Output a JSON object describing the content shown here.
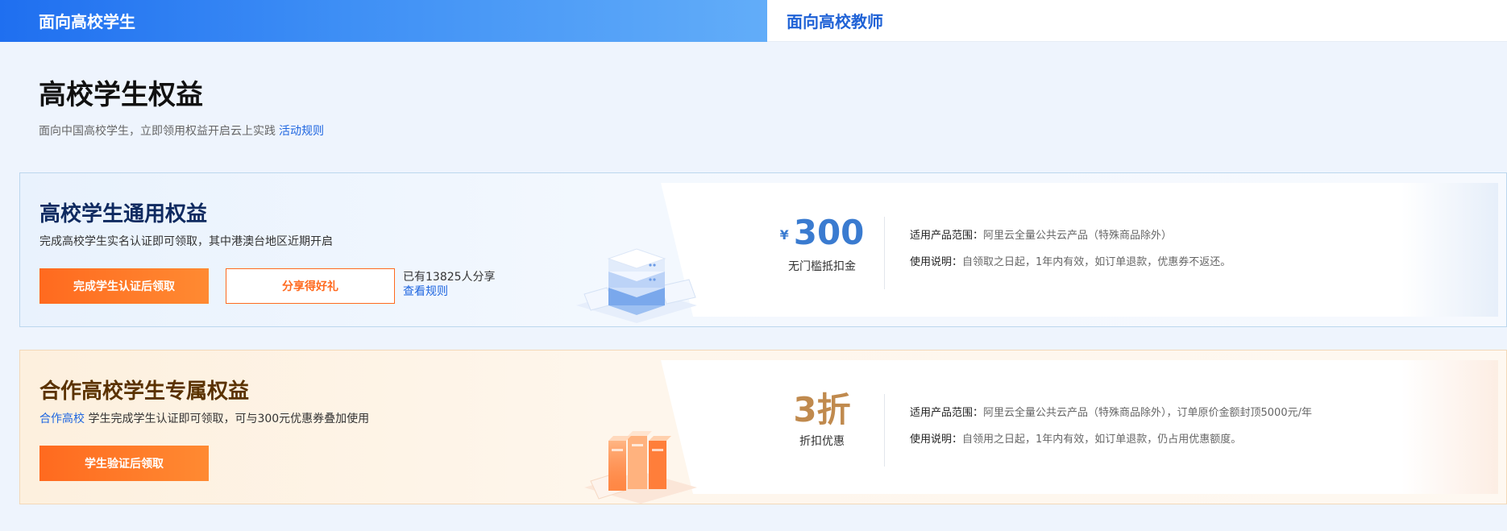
{
  "tabs": {
    "active": "面向高校学生",
    "inactive": "面向高校教师"
  },
  "page": {
    "title": "高校学生权益",
    "subtitle": "面向中国高校学生，立即领用权益开启云上实践",
    "rules_link": "活动规则"
  },
  "cards": [
    {
      "title": "高校学生通用权益",
      "desc": "完成高校学生实名认证即可领取，其中港澳台地区近期开启",
      "primary_btn": "完成学生认证后领取",
      "secondary_btn": "分享得好礼",
      "share_count": "已有13825人分享",
      "view_rules": "查看规则",
      "currency": "¥",
      "amount": "300",
      "amount_label": "无门槛抵扣金",
      "scope_label": "适用产品范围：",
      "scope_value": "阿里云全量公共云产品（特殊商品除外）",
      "usage_label": "使用说明：",
      "usage_value": "自领取之日起，1年内有效，如订单退款，优惠券不返还。"
    },
    {
      "title": "合作高校学生专属权益",
      "desc_highlight": "合作高校",
      "desc": "学生完成学生认证即可领取，可与300元优惠券叠加使用",
      "primary_btn": "学生验证后领取",
      "amount": "3折",
      "amount_label": "折扣优惠",
      "scope_label": "适用产品范围：",
      "scope_value": "阿里云全量公共云产品（特殊商品除外），订单原价金额封顶5000元/年",
      "usage_label": "使用说明：",
      "usage_value": "自领用之日起，1年内有效，如订单退款，仍占用优惠额度。"
    }
  ],
  "colors": {
    "brand_blue": "#1f6ff0",
    "orange": "#ff6a1f",
    "gold": "#c08a4e"
  }
}
